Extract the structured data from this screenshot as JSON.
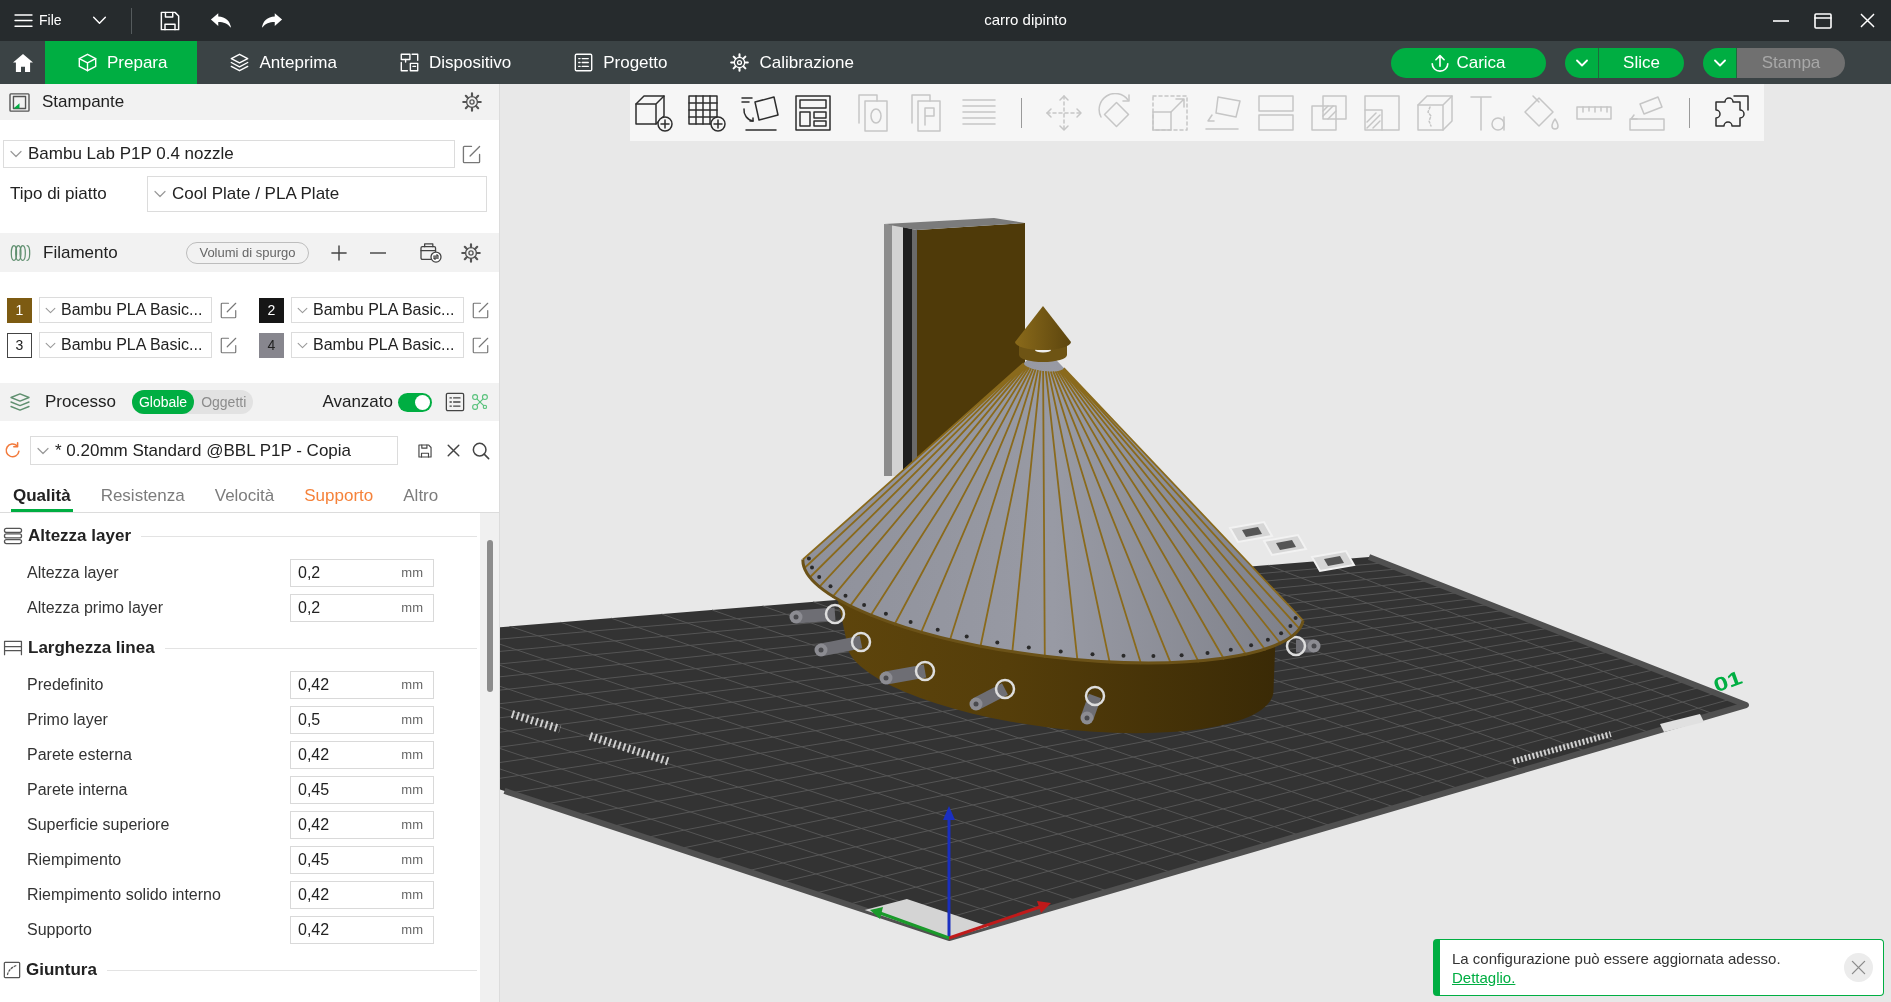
{
  "title_bar": {
    "menu_label": "File",
    "title": "carro dipinto"
  },
  "nav": {
    "tabs": [
      {
        "label": "Prepara",
        "selected": true
      },
      {
        "label": "Anteprima",
        "selected": false
      },
      {
        "label": "Dispositivo",
        "selected": false
      },
      {
        "label": "Progetto",
        "selected": false
      },
      {
        "label": "Calibrazione",
        "selected": false
      }
    ],
    "actions": [
      {
        "label": "Carica",
        "disabled": false,
        "dropdown": false
      },
      {
        "label": "Slice",
        "disabled": false,
        "dropdown": true
      },
      {
        "label": "Stampa",
        "disabled": true,
        "dropdown": true
      }
    ]
  },
  "printer": {
    "title": "Stampante",
    "preset": "Bambu Lab P1P 0.4 nozzle",
    "plate_label": "Tipo di piatto",
    "plate_type": "Cool Plate / PLA Plate"
  },
  "filament": {
    "title": "Filamento",
    "purge_button": "Volumi di spurgo",
    "slots": [
      {
        "number": "1",
        "color": "#7d5b12",
        "name": "Bambu PLA Basic..."
      },
      {
        "number": "2",
        "color": "#161616",
        "name": "Bambu PLA Basic..."
      },
      {
        "number": "3",
        "color": "#ffffff",
        "name": "Bambu PLA Basic..."
      },
      {
        "number": "4",
        "color": "#87868e",
        "name": "Bambu PLA Basic..."
      }
    ]
  },
  "process": {
    "title": "Processo",
    "scope": [
      {
        "label": "Globale",
        "selected": true
      },
      {
        "label": "Oggetti",
        "selected": false
      }
    ],
    "advanced_label": "Avanzato",
    "advanced": true,
    "preset": "* 0.20mm Standard @BBL P1P - Copia",
    "tabs": [
      {
        "label": "Qualità",
        "selected": true,
        "modified": false
      },
      {
        "label": "Resistenza",
        "selected": false,
        "modified": false
      },
      {
        "label": "Velocità",
        "selected": false,
        "modified": false
      },
      {
        "label": "Supporto",
        "selected": false,
        "modified": true
      },
      {
        "label": "Altro",
        "selected": false,
        "modified": false
      }
    ],
    "groups": [
      {
        "title": "Altezza layer",
        "rows": [
          {
            "label": "Altezza layer",
            "value": "0,2",
            "unit": "mm"
          },
          {
            "label": "Altezza primo layer",
            "value": "0,2",
            "unit": "mm"
          }
        ]
      },
      {
        "title": "Larghezza linea",
        "rows": [
          {
            "label": "Predefinito",
            "value": "0,42",
            "unit": "mm"
          },
          {
            "label": "Primo layer",
            "value": "0,5",
            "unit": "mm"
          },
          {
            "label": "Parete esterna",
            "value": "0,42",
            "unit": "mm"
          },
          {
            "label": "Parete interna",
            "value": "0,45",
            "unit": "mm"
          },
          {
            "label": "Superficie superiore",
            "value": "0,42",
            "unit": "mm"
          },
          {
            "label": "Riempimento",
            "value": "0,45",
            "unit": "mm"
          },
          {
            "label": "Riempimento solido interno",
            "value": "0,42",
            "unit": "mm"
          },
          {
            "label": "Supporto",
            "value": "0,42",
            "unit": "mm"
          }
        ]
      },
      {
        "title": "Giuntura"
      }
    ]
  },
  "toolbar": {
    "groups": [
      [
        {
          "disabled": false
        },
        {
          "disabled": false
        },
        {
          "disabled": false
        },
        {
          "disabled": false
        },
        {
          "disabled": true
        },
        {
          "disabled": true
        },
        {
          "disabled": true
        }
      ],
      [
        {
          "disabled": true
        },
        {
          "disabled": true
        },
        {
          "disabled": true
        },
        {
          "disabled": true
        },
        {
          "disabled": true
        },
        {
          "disabled": true
        },
        {
          "disabled": true
        },
        {
          "disabled": true
        },
        {
          "disabled": true
        },
        {
          "disabled": true
        },
        {
          "disabled": true
        },
        {
          "disabled": true
        }
      ],
      [
        {
          "disabled": false
        }
      ]
    ]
  },
  "viewport": {
    "plate_number": "01"
  },
  "notification": {
    "message": "La configurazione può essere aggiornata adesso.",
    "link": "Dettaglio."
  }
}
